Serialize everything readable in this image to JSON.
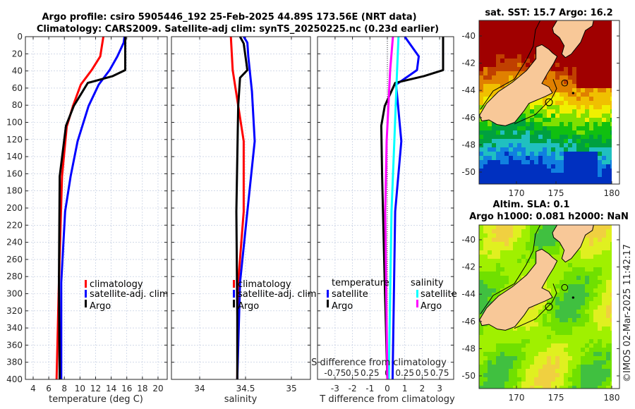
{
  "title_line1": "Argo profile: csiro 5905446_192 25-Feb-2025 44.89S 173.56E (NRT data)",
  "title_line2": "Climatology: CARS2009. Satellite-adj clim: synTS_20250225.nc (0.23d earlier)",
  "colors": {
    "climatology": "#ff0000",
    "satellite": "#0000ff",
    "argo": "#000000",
    "sal_satellite": "#00ffff",
    "sal_argo": "#ff00ff"
  },
  "chart_data": [
    {
      "type": "line",
      "xlabel": "temperature (deg C)",
      "ylabel": "",
      "xlim": [
        3,
        21
      ],
      "ylim": [
        400,
        0
      ],
      "grid": true,
      "xticks": [
        4,
        6,
        8,
        10,
        12,
        14,
        16,
        18,
        20
      ],
      "yticks": [
        0,
        20,
        40,
        60,
        80,
        100,
        120,
        140,
        160,
        180,
        200,
        220,
        240,
        260,
        280,
        300,
        320,
        340,
        360,
        380,
        400
      ],
      "legend": "center-right",
      "series": [
        {
          "name": "climatology",
          "depth": [
            0,
            23,
            39,
            56,
            81,
            105,
            163,
            287,
            400
          ],
          "values": [
            13.0,
            12.6,
            11.5,
            10.1,
            9.1,
            8.3,
            7.7,
            7.3,
            7.0
          ]
        },
        {
          "name": "satellite-adj. clim",
          "depth": [
            0,
            7,
            23,
            39,
            56,
            81,
            122,
            163,
            204,
            287,
            400
          ],
          "values": [
            15.7,
            15.6,
            14.8,
            13.8,
            12.4,
            11.1,
            9.7,
            8.8,
            8.1,
            7.6,
            7.6
          ]
        },
        {
          "name": "Argo",
          "depth": [
            0,
            39,
            46,
            54,
            81,
            104,
            163,
            287,
            400
          ],
          "values": [
            15.8,
            15.8,
            14.2,
            11.0,
            9.2,
            8.2,
            7.4,
            7.3,
            7.4
          ]
        }
      ]
    },
    {
      "type": "line",
      "xlabel": "salinity",
      "xlim": [
        33.7,
        35.2
      ],
      "ylim": [
        400,
        0
      ],
      "grid": true,
      "xticks": [
        34,
        34.5,
        35
      ],
      "legend": "center-right",
      "series": [
        {
          "name": "climatology",
          "depth": [
            0,
            39,
            122,
            204,
            287,
            400
          ],
          "values": [
            34.34,
            34.36,
            34.48,
            34.48,
            34.42,
            34.41
          ]
        },
        {
          "name": "satellite-adj. clim",
          "depth": [
            0,
            7,
            23,
            64,
            122,
            204,
            287,
            400
          ],
          "values": [
            34.48,
            34.52,
            34.53,
            34.57,
            34.6,
            34.52,
            34.44,
            34.41
          ]
        },
        {
          "name": "Argo",
          "depth": [
            0,
            8,
            39,
            48,
            81,
            204,
            326,
            400
          ],
          "values": [
            34.44,
            34.48,
            34.52,
            34.44,
            34.42,
            34.4,
            34.41,
            34.41
          ]
        }
      ]
    },
    {
      "type": "line",
      "xlabel": "T difference from climatology",
      "x2label": "S difference from climatology",
      "xlim": [
        -4,
        3.8
      ],
      "ylim": [
        400,
        0
      ],
      "grid": true,
      "xticks": [
        -3,
        -2,
        -1,
        0,
        1,
        2,
        3
      ],
      "x2ticks": [
        "-0.75",
        "0.5",
        "0.25",
        "0",
        "0.25",
        "0.5",
        "0.75"
      ],
      "legend_groups": [
        "temperature",
        "salinity"
      ],
      "series": [
        {
          "name": "satellite",
          "group": "temperature",
          "depth": [
            0,
            23,
            39,
            56,
            122,
            204,
            400
          ],
          "values": [
            1.0,
            1.8,
            1.7,
            0.5,
            0.8,
            0.45,
            0.3
          ]
        },
        {
          "name": "Argo",
          "group": "temperature",
          "depth": [
            0,
            39,
            46,
            54,
            81,
            104,
            163,
            287,
            400
          ],
          "values": [
            3.2,
            3.2,
            2.1,
            0.45,
            -0.15,
            -0.35,
            -0.3,
            -0.15,
            0.0
          ]
        },
        {
          "name": "satellite",
          "group": "salinity",
          "depth": [
            0,
            39,
            122,
            204,
            400
          ],
          "values": [
            0.16,
            0.14,
            0.1,
            0.06,
            0.02
          ]
        },
        {
          "name": "Argo",
          "group": "salinity",
          "depth": [
            0,
            39,
            122,
            204,
            400
          ],
          "values": [
            0.08,
            0.04,
            -0.01,
            -0.03,
            0.0
          ]
        }
      ]
    }
  ],
  "legend": {
    "climatology": "climatology",
    "satellite_adj": "satellite-adj. clim",
    "argo": "Argo",
    "temperature": "temperature",
    "salinity": "salinity",
    "satellite": "satellite"
  },
  "maps": [
    {
      "title": "sat. SST: 15.7 Argo: 16.2",
      "xticks": [
        "170",
        "175",
        "180"
      ],
      "yticks": [
        "-40",
        "-42",
        "-44",
        "-46",
        "-48",
        "-50"
      ]
    },
    {
      "title_line1": "Altim. SLA: 0.1",
      "title_line2": "Argo h1000: 0.081 h2000: NaN",
      "xticks": [
        "170",
        "175",
        "180"
      ],
      "yticks": [
        "-40",
        "-42",
        "-44",
        "-46",
        "-48",
        "-50"
      ]
    }
  ],
  "copyright": "©IMOS 02-Mar-2025 11:42:17"
}
